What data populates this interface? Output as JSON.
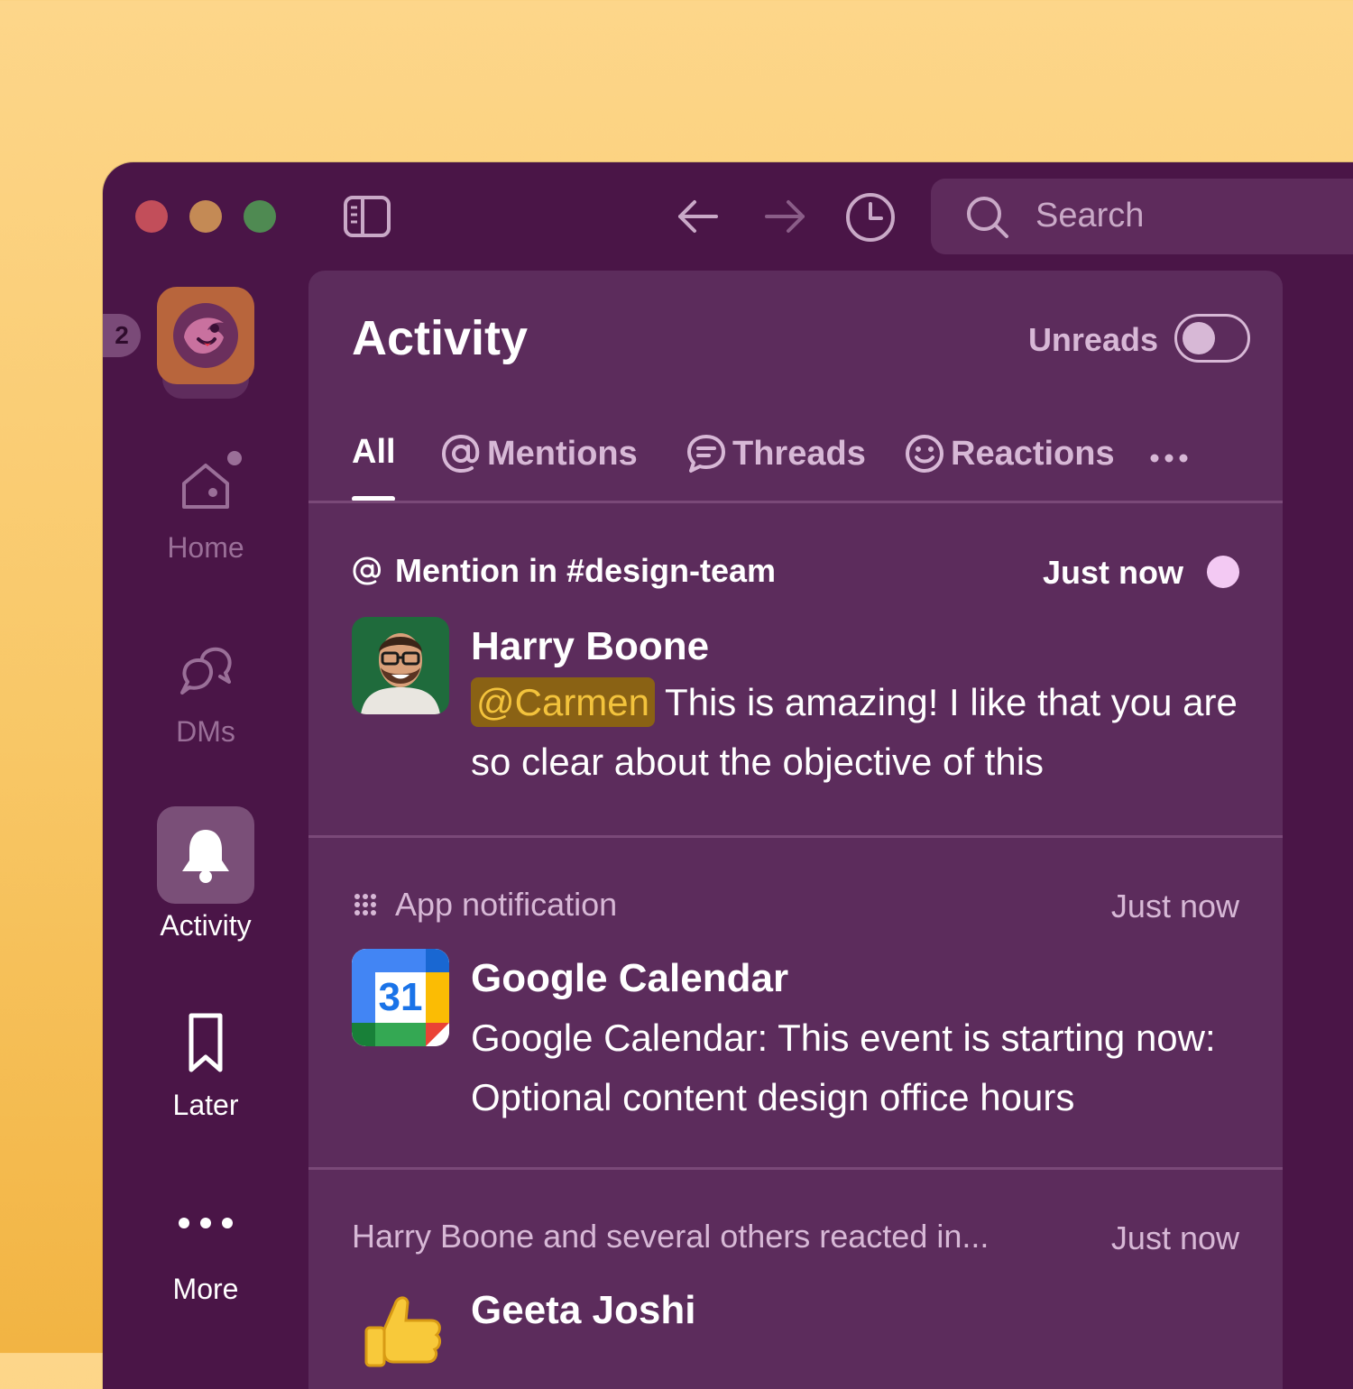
{
  "window": {
    "search_placeholder": "Search"
  },
  "rail": {
    "badge_count": "2",
    "items": [
      {
        "label": "Home"
      },
      {
        "label": "DMs"
      },
      {
        "label": "Activity"
      },
      {
        "label": "Later"
      },
      {
        "label": "More"
      }
    ]
  },
  "panel": {
    "title": "Activity",
    "unreads_label": "Unreads",
    "tabs": [
      {
        "label": "All"
      },
      {
        "label": "Mentions"
      },
      {
        "label": "Threads"
      },
      {
        "label": "Reactions"
      }
    ],
    "items": [
      {
        "context": "Mention in #design-team",
        "time": "Just now",
        "author": "Harry Boone",
        "mention": "@Carmen",
        "text": "This is amazing! I like that you are so clear about the objective of this"
      },
      {
        "context": "App notification",
        "time": "Just now",
        "author": "Google Calendar",
        "calendar_day": "31",
        "text": "Google Calendar: This event is starting now: Optional content design office hours"
      },
      {
        "context": "Harry Boone and several others reacted in...",
        "time": "Just now",
        "author": "Geeta Joshi"
      }
    ]
  }
}
